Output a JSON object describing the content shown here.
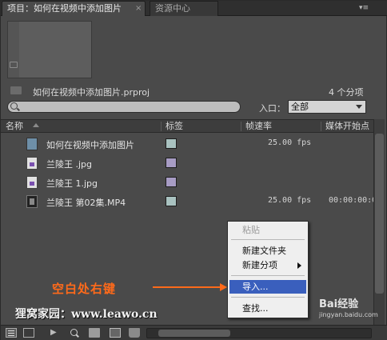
{
  "tabs": [
    {
      "label": "项目：如何在视频中添加图片",
      "close": "×"
    },
    {
      "label": "资源中心"
    }
  ],
  "panel_menu_glyph": "▾≡",
  "project": {
    "file_name": "如何在视频中添加图片.prproj",
    "item_count": "4 个分项"
  },
  "search": {
    "value": "",
    "entry_label": "入口：",
    "entry_value": "全部"
  },
  "columns": {
    "name": "名称",
    "label": "标签",
    "frame_rate": "帧速率",
    "media_start": "媒体开始点"
  },
  "items": [
    {
      "name": "如何在视频中添加图片",
      "type": "sequence",
      "icon": "sequence-icon",
      "label_color": "#a9c2c0",
      "frame_rate": "25.00 fps",
      "media_start": ""
    },
    {
      "name": "兰陵王 .jpg",
      "type": "image",
      "icon": "image-file-icon",
      "label_color": "#a79cc4",
      "frame_rate": "",
      "media_start": ""
    },
    {
      "name": "兰陵王 1.jpg",
      "type": "image",
      "icon": "image-file-icon",
      "label_color": "#a79cc4",
      "frame_rate": "",
      "media_start": ""
    },
    {
      "name": "兰陵王 第02集.MP4",
      "type": "video",
      "icon": "video-file-icon",
      "label_color": "#a9c2c0",
      "frame_rate": "25.00 fps",
      "media_start": "00:00:00:0"
    }
  ],
  "context_menu": {
    "paste": "粘贴",
    "new_bin": "新建文件夹",
    "new_item": "新建分项",
    "import": "导入...",
    "find": "查找..."
  },
  "annotation": {
    "text": "空白处右键",
    "color": "#ff6a1a"
  },
  "site_caption": "狸窝家园：www.leawo.cn",
  "watermark": {
    "logo": "Bai经验",
    "url": "jingyan.baidu.com"
  },
  "bottom_bar": {
    "auto_glyph": "▶"
  }
}
